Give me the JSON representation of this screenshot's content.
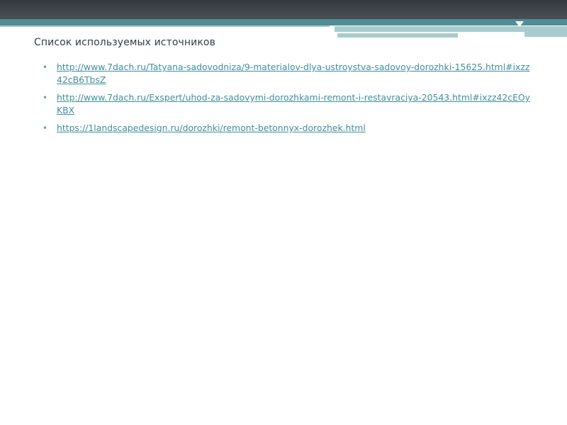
{
  "title": "Список используемых источников",
  "bullet_glyph": "•",
  "colors": {
    "header_dark": "#3c4148",
    "header_teal": "#4f8e92",
    "header_light": "#a8cbcf",
    "link": "#3f8f99",
    "title": "#2e3d44"
  },
  "sources": [
    "http://www.7dach.ru/Tatyana-sadovodniza/9-materialov-dlya-ustroystva-sadovoy-dorozhki-15625.html#ixzz42cB6TbsZ",
    "http://www.7dach.ru/Exspert/uhod-za-sadovymi-dorozhkami-remont-i-restavraciya-20543.html#ixzz42cEOyKBX",
    "https://1landscapedesign.ru/dorozhki/remont-betonnyx-dorozhek.html"
  ]
}
